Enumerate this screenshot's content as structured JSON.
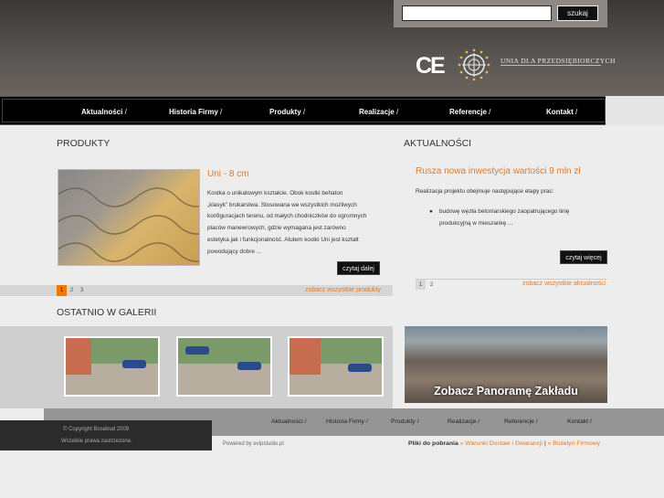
{
  "search": {
    "placeholder": "",
    "button": "szukaj"
  },
  "logo": {
    "ce_mark": "CE",
    "union_text": "UNIA DLA PRZEDSIĘBIORCZYCH"
  },
  "nav": {
    "separator": "/",
    "items": [
      "Aktualności",
      "Historia Firmy",
      "Produkty",
      "Realizacje",
      "Referencje",
      "Kontakt"
    ]
  },
  "products": {
    "heading": "PRODUKTY",
    "title": "Uni - 8 cm",
    "lines": [
      "Kostka o unikatowym kształcie. Obok kostki behaton",
      "„klasyk\" brukarstwa. Stosowana we wszystkich możliwych",
      "konfiguracjach terenu, od małych chodniczków do ogromnych",
      "placów manewrowych, gdzie wymagana jest zarówno",
      "estetyka jak i funkcjonalność. Atutem kostki Uni jest kształt",
      "powodujący dobre ..."
    ],
    "read_more": "czytaj dalej",
    "pages": [
      "1",
      "2",
      "3"
    ],
    "see_all": "zobacz wszystkie produkty"
  },
  "news": {
    "heading": "AKTUALNOŚCI",
    "title": "Rusza nowa inwestycja wartości 9 mln zł",
    "intro": "Realizacja projektu obejmuje następujące etapy prac:",
    "bullet_lines": [
      "budowę węzła betoniarskiego zaopatrującego linię",
      "produkcyjną w mieszankę ..."
    ],
    "read_more": "czytaj więcej",
    "pages": [
      "1",
      "2"
    ],
    "see_all": "zobacz wszystkie aktualności"
  },
  "gallery": {
    "heading": "OSTATNIO W GALERII"
  },
  "panorama": {
    "label": "Zobacz Panoramę Zakładu"
  },
  "footer": {
    "copyright": "© Copyright Bosebud 2009",
    "rights": "Wszelkie prawa zastrzeżone.",
    "powered": "Powered by evipstudio.pl",
    "nav": [
      "Aktualności",
      "Historia Firmy",
      "Produkty",
      "Realizacje",
      "Referencje",
      "Kontakt"
    ],
    "downloads_label": "Pliki do pobrania",
    "arrow": "»",
    "link1": "Warunki Dostaw i Gwarancji",
    "pipe": "|",
    "link2": "Biuletyn Firmowy"
  }
}
